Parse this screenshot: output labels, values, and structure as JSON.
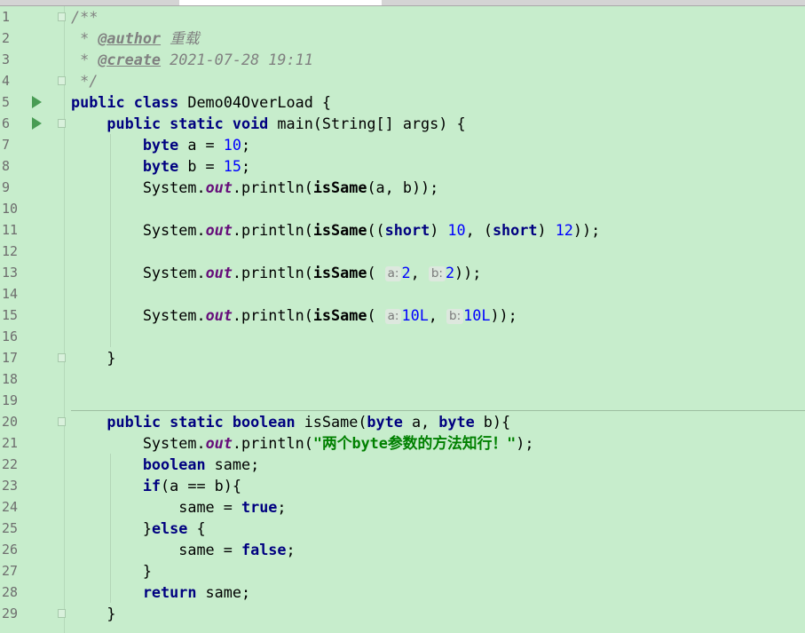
{
  "editor": {
    "tabs": [
      {
        "label": "",
        "active": false
      },
      {
        "label": "",
        "active": true
      }
    ],
    "background": "#C7EDCC",
    "line_numbers": [
      "1",
      "2",
      "3",
      "4",
      "5",
      "6",
      "7",
      "8",
      "9",
      "10",
      "11",
      "12",
      "13",
      "14",
      "15",
      "16",
      "17",
      "18",
      "19",
      "20",
      "21",
      "22",
      "23",
      "24",
      "25",
      "26",
      "27",
      "28",
      "29"
    ],
    "run_icons_on_lines": [
      5,
      6
    ],
    "code": {
      "l1": {
        "cmt": "/**"
      },
      "l2": {
        "prefix": " * ",
        "tag": "@author",
        "text": " 重载"
      },
      "l3": {
        "prefix": " * ",
        "tag": "@create",
        "text": " 2021-07-28 19:11"
      },
      "l4": {
        "cmt": " */"
      },
      "l5": {
        "kw1": "public class",
        "rest": " Demo04OverLoad {"
      },
      "l6": {
        "indent": "    ",
        "kw1": "public static void",
        "rest": " main(String[] args) {"
      },
      "l7": {
        "indent": "        ",
        "kw": "byte",
        "mid": " a = ",
        "num": "10",
        "end": ";"
      },
      "l8": {
        "indent": "        ",
        "kw": "byte",
        "mid": " b = ",
        "num": "15",
        "end": ";"
      },
      "l9": {
        "indent": "        ",
        "obj": "System.",
        "field": "out",
        "call": ".println(",
        "method": "isSame",
        "args": "(a, b));"
      },
      "l11": {
        "indent": "        ",
        "obj": "System.",
        "field": "out",
        "call": ".println(",
        "method": "isSame",
        "p1": "((",
        "kw_a": "short",
        "p2": ") ",
        "num_a": "10",
        "p3": ", (",
        "kw_b": "short",
        "p4": ") ",
        "num_b": "12",
        "end": "));"
      },
      "l13": {
        "indent": "        ",
        "obj": "System.",
        "field": "out",
        "call": ".println(",
        "method": "isSame",
        "open": "( ",
        "hint_a": "a:",
        "num_a": "2",
        "sep": ", ",
        "hint_b": "b:",
        "num_b": "2",
        "end": "));"
      },
      "l15": {
        "indent": "        ",
        "obj": "System.",
        "field": "out",
        "call": ".println(",
        "method": "isSame",
        "open": "( ",
        "hint_a": "a:",
        "num_a": "10L",
        "sep": ", ",
        "hint_b": "b:",
        "num_b": "10L",
        "end": "));"
      },
      "l17": {
        "indent": "    ",
        "text": "}"
      },
      "l20": {
        "indent": "    ",
        "kw1": "public static boolean",
        "mid": " isSame(",
        "kw2": "byte",
        "mid2": " a, ",
        "kw3": "byte",
        "end": " b){"
      },
      "l21": {
        "indent": "        ",
        "obj": "System.",
        "field": "out",
        "call": ".println(",
        "str": "\"两个byte参数的方法知行！\"",
        "end": ");"
      },
      "l22": {
        "indent": "        ",
        "kw": "boolean",
        "end": " same;"
      },
      "l23": {
        "indent": "        ",
        "kw": "if",
        "end": "(a == b){"
      },
      "l24": {
        "indent": "            ",
        "mid": "same = ",
        "kw": "true",
        "end": ";"
      },
      "l25": {
        "indent": "        ",
        "pre": "}",
        "kw": "else",
        "end": " {"
      },
      "l26": {
        "indent": "            ",
        "mid": "same = ",
        "kw": "false",
        "end": ";"
      },
      "l27": {
        "indent": "        ",
        "text": "}"
      },
      "l28": {
        "indent": "        ",
        "kw": "return",
        "end": " same;"
      },
      "l29": {
        "indent": "    ",
        "text": "}"
      }
    }
  }
}
